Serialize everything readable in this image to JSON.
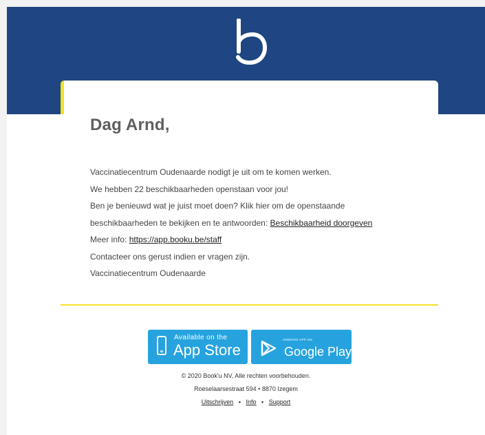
{
  "email": {
    "greeting": "Dag Arnd,",
    "body": {
      "line1": "Vaccinatiecentrum Oudenaarde nodigt je uit om te komen werken.",
      "line2": "We hebben 22 beschikbaarheden openstaan voor jou!",
      "line3": "Ben je benieuwd wat je juist moet doen? Klik hier om de openstaande",
      "line4_prefix": "beschikbaarheden te bekijken en te antwoorden:",
      "line4_link": "Beschikbaarheid doorgeven",
      "line5_prefix": "Meer info:",
      "line5_link": "https://app.booku.be/staff",
      "line6": "Contacteer ons gerust indien er vragen zijn.",
      "signature": "Vaccinatiecentrum Oudenaarde"
    }
  },
  "stores": {
    "app_store_small": "Available on the",
    "app_store_large": "App Store",
    "google_play_small": "ANDROID APP ON",
    "google_play_large": "Google Play"
  },
  "footer": {
    "copyright": "© 2020 Book'u NV, Alle rechten voorbehouden.",
    "address": "Roeselaarsestraat 594 • 8870 Izegem",
    "links": [
      "Uitschrijven",
      "Info",
      "Support"
    ],
    "separator": "•"
  },
  "colors": {
    "header_blue": "#1f4582",
    "accent_yellow": "#f2e125",
    "store_blue": "#26a3de"
  },
  "icons": {
    "logo": "booku-logo",
    "app_store": "phone-icon",
    "google_play": "play-icon"
  }
}
